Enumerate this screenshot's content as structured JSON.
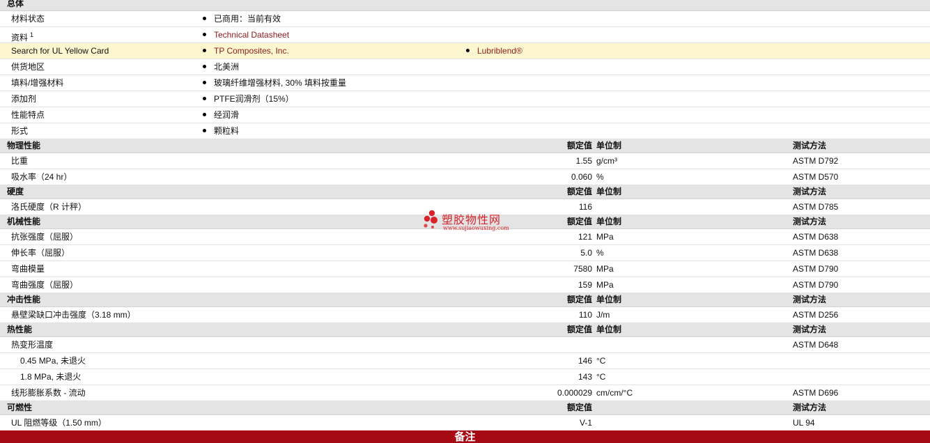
{
  "general": {
    "section_title": "总体",
    "rows": [
      {
        "label": "材料状态",
        "items": [
          "已商用：当前有效"
        ]
      },
      {
        "label": "资料",
        "sup": "1",
        "items": [
          "Technical Datasheet"
        ]
      },
      {
        "label": "Search for UL Yellow Card",
        "items": [
          "TP Composites, Inc.",
          "Lubriblend®"
        ]
      },
      {
        "label": "供货地区",
        "items": [
          "北美洲"
        ]
      },
      {
        "label": "填料/增强材料",
        "items": [
          "玻璃纤维增强材料, 30% 填料按重量"
        ]
      },
      {
        "label": "添加剂",
        "items": [
          "PTFE润滑剂（15%）"
        ]
      },
      {
        "label": "性能特点",
        "items": [
          "经润滑"
        ]
      },
      {
        "label": "形式",
        "items": [
          "颗粒料"
        ]
      }
    ]
  },
  "headers": {
    "value": "额定值",
    "unit": "单位制",
    "test": "测试方法"
  },
  "physical": {
    "title": "物理性能",
    "rows": [
      {
        "label": "比重",
        "value": "1.55",
        "unit": "g/cm³",
        "test": "ASTM D792"
      },
      {
        "label": "吸水率（24 hr）",
        "value": "0.060",
        "unit": "%",
        "test": "ASTM D570"
      }
    ]
  },
  "hardness": {
    "title": "硬度",
    "rows": [
      {
        "label": "洛氏硬度（R 计秤）",
        "value": "116",
        "unit": "",
        "test": "ASTM D785"
      }
    ]
  },
  "mechanical": {
    "title": "机械性能",
    "rows": [
      {
        "label": "抗张强度（屈服）",
        "value": "121",
        "unit": "MPa",
        "test": "ASTM D638"
      },
      {
        "label": "伸长率（屈服）",
        "value": "5.0",
        "unit": "%",
        "test": "ASTM D638"
      },
      {
        "label": "弯曲模量",
        "value": "7580",
        "unit": "MPa",
        "test": "ASTM D790"
      },
      {
        "label": "弯曲强度（屈服）",
        "value": "159",
        "unit": "MPa",
        "test": "ASTM D790"
      }
    ]
  },
  "impact": {
    "title": "冲击性能",
    "rows": [
      {
        "label": "悬壁梁缺口冲击强度（3.18 mm）",
        "value": "110",
        "unit": "J/m",
        "test": "ASTM D256"
      }
    ]
  },
  "thermal": {
    "title": "热性能",
    "rows": [
      {
        "label": "热变形温度",
        "value": "",
        "unit": "",
        "test": "ASTM D648"
      },
      {
        "label": "0.45 MPa, 未退火",
        "value": "146",
        "unit": "°C",
        "test": ""
      },
      {
        "label": "1.8 MPa, 未退火",
        "value": "143",
        "unit": "°C",
        "test": ""
      },
      {
        "label": "线形膨胀系数  - 流动",
        "value": "0.000029",
        "unit": "cm/cm/°C",
        "test": "ASTM D696"
      }
    ]
  },
  "flammability": {
    "title": "可燃性",
    "rows": [
      {
        "label": "UL 阻燃等级（1.50 mm）",
        "value": "V-1",
        "unit": "",
        "test": "UL 94"
      }
    ]
  },
  "footer": {
    "label": "备注"
  },
  "watermark": {
    "title": "塑胶物性网",
    "url": "www.sujiaowuxing.com"
  },
  "colors": {
    "footer_bg": "#a50a14",
    "link": "#8b1a1a",
    "highlight": "#fdf7cf",
    "section_bg": "#e4e4e4",
    "watermark": "#d8232a"
  }
}
